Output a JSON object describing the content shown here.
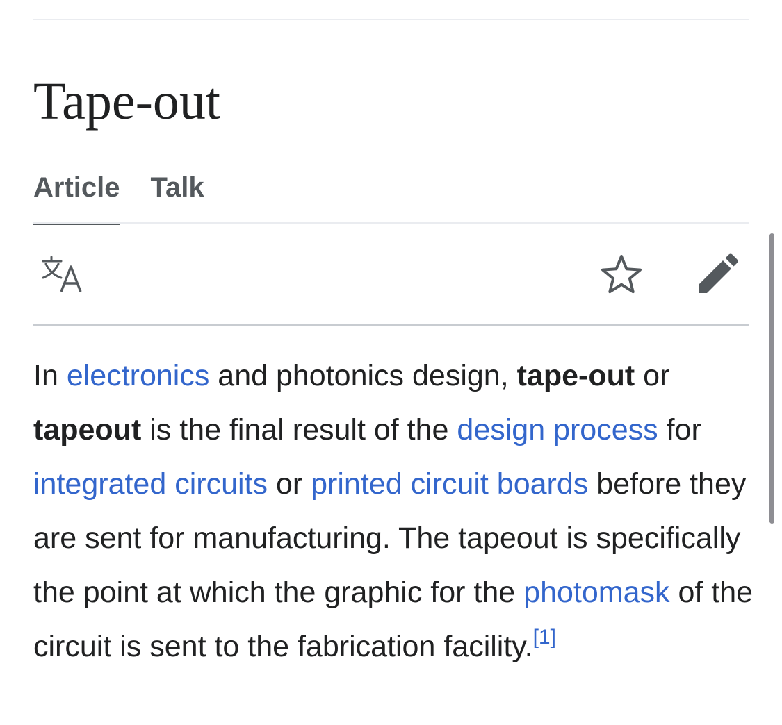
{
  "article": {
    "title": "Tape-out"
  },
  "tabs": [
    {
      "label": "Article",
      "active": true
    },
    {
      "label": "Talk",
      "active": false
    }
  ],
  "toolbar": {
    "language_icon": "translate-icon",
    "watch_icon": "star-outline-icon",
    "edit_icon": "pencil-icon"
  },
  "lead": {
    "s1": "In ",
    "link_electronics": "electronics",
    "s2": " and photonics design, ",
    "bold_tape_out": "tape-out",
    "s3": " or ",
    "bold_tapeout": "tapeout",
    "s4": " is the final result of the ",
    "link_design_process": "design process",
    "s5": " for ",
    "link_integrated_circuits": "integrated circuits",
    "s6": " or ",
    "link_printed_circuit_boards": "printed circuit boards",
    "s7": " before they are sent for manufacturing. The tapeout is specifically the point at which the graphic for the ",
    "link_photomask": "photomask",
    "s8": " of the circuit is sent to the fabrication facility.",
    "ref_1": "[1]"
  },
  "colors": {
    "link": "#3366cc",
    "text": "#202122",
    "tab": "#54595d",
    "divider": "#c8ccd1"
  }
}
